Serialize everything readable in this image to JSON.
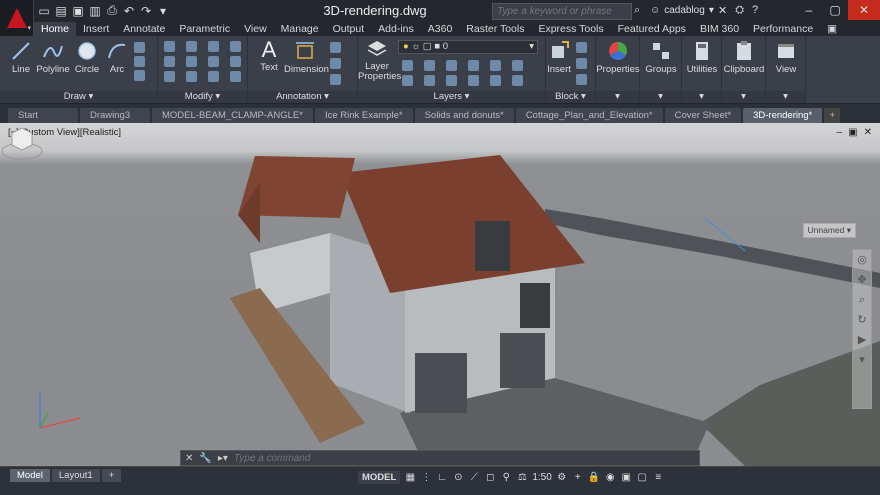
{
  "app": {
    "title": "3D-rendering.dwg"
  },
  "search": {
    "placeholder": "Type a keyword or phrase"
  },
  "user": {
    "name": "cadablog"
  },
  "ribbon_tabs": [
    {
      "label": "Home"
    },
    {
      "label": "Insert"
    },
    {
      "label": "Annotate"
    },
    {
      "label": "Parametric"
    },
    {
      "label": "View"
    },
    {
      "label": "Manage"
    },
    {
      "label": "Output"
    },
    {
      "label": "Add-ins"
    },
    {
      "label": "A360"
    },
    {
      "label": "Raster Tools"
    },
    {
      "label": "Express Tools"
    },
    {
      "label": "Featured Apps"
    },
    {
      "label": "BIM 360"
    },
    {
      "label": "Performance"
    }
  ],
  "panels": {
    "draw": {
      "title": "Draw",
      "line": "Line",
      "polyline": "Polyline",
      "circle": "Circle",
      "arc": "Arc"
    },
    "modify": {
      "title": "Modify"
    },
    "annotation": {
      "title": "Annotation",
      "text": "Text",
      "dimension": "Dimension"
    },
    "layers": {
      "title": "Layers",
      "layer_properties": "Layer\nProperties",
      "current_layer": "0"
    },
    "block": {
      "title": "Block",
      "insert": "Insert"
    },
    "properties": {
      "title": "Properties"
    },
    "groups": {
      "title": "Groups"
    },
    "utilities": {
      "title": "Utilities"
    },
    "clipboard": {
      "title": "Clipboard"
    },
    "view": {
      "title": "View"
    }
  },
  "file_tabs": [
    {
      "label": "Start"
    },
    {
      "label": "Drawing3"
    },
    {
      "label": "MODEL-BEAM_CLAMP-ANGLE*"
    },
    {
      "label": "Ice Rink Example*"
    },
    {
      "label": "Solids and donuts*"
    },
    {
      "label": "Cottage_Plan_and_Elevation*"
    },
    {
      "label": "Cover Sheet*"
    },
    {
      "label": "3D-rendering*"
    }
  ],
  "viewport": {
    "label": "[−][Custom View][Realistic]",
    "ucs_name": "Unnamed"
  },
  "command": {
    "placeholder": "Type a command"
  },
  "layout_tabs": [
    {
      "label": "Model"
    },
    {
      "label": "Layout1"
    }
  ],
  "status": {
    "space": "MODEL",
    "scale": "1:50"
  },
  "colors": {
    "accent": "#c8161d",
    "ribbon": "#3a3f4a"
  }
}
